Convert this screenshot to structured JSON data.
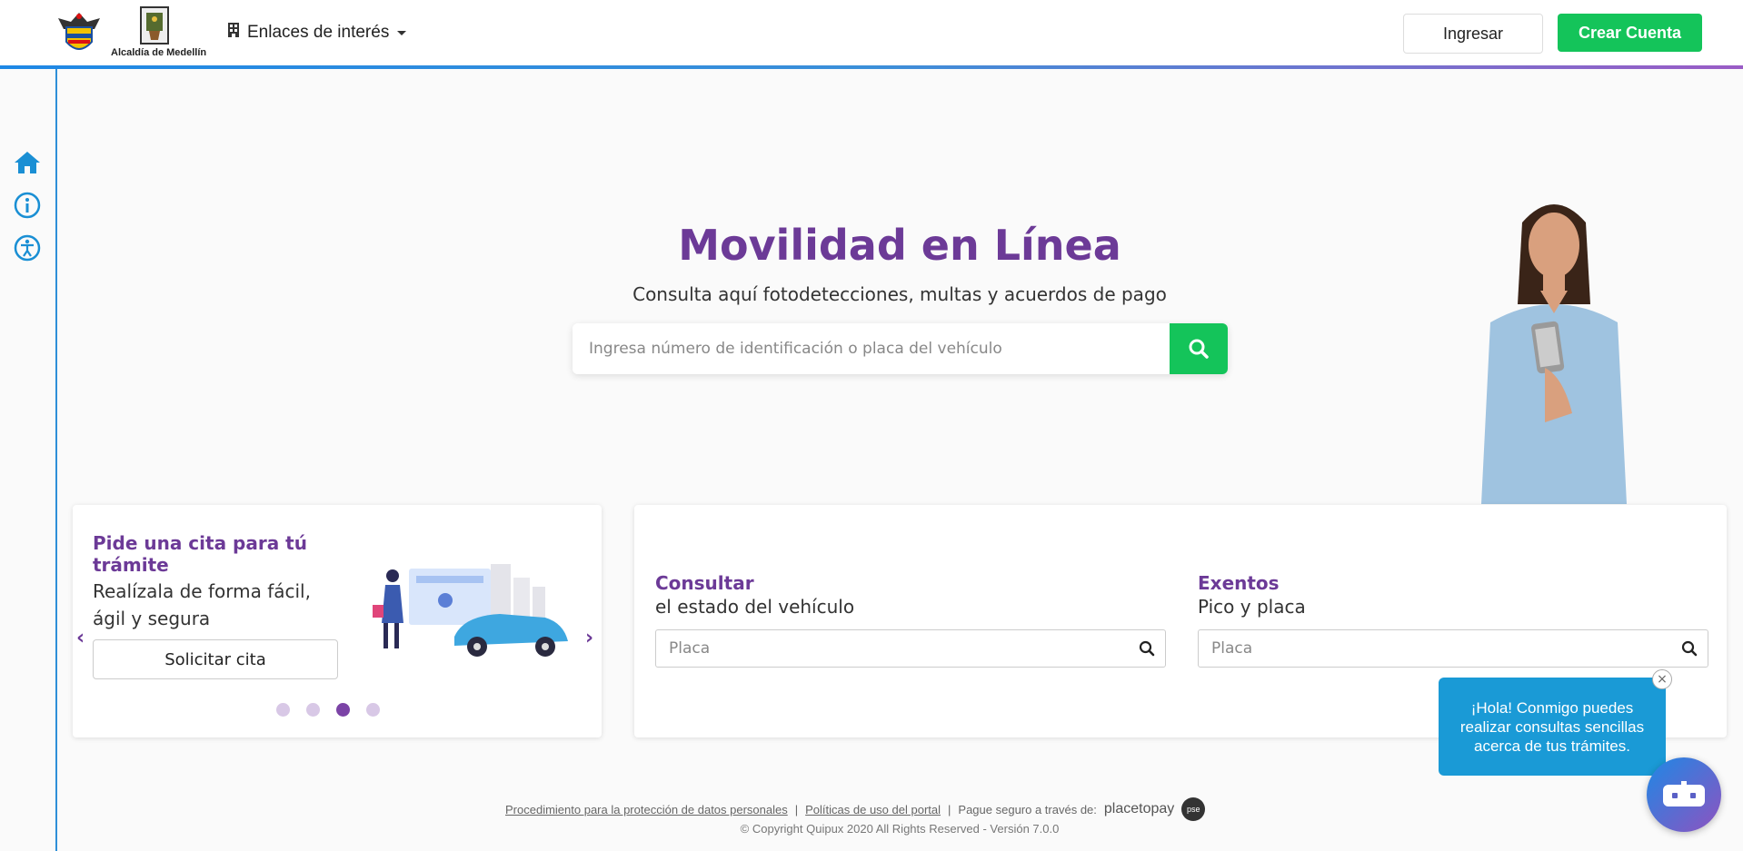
{
  "header": {
    "logo_text": "Alcaldía de Medellín",
    "links_menu_label": "Enlaces de interés",
    "login_label": "Ingresar",
    "signup_label": "Crear Cuenta"
  },
  "sidebar": {
    "items": [
      {
        "icon": "home-icon"
      },
      {
        "icon": "info-icon"
      },
      {
        "icon": "accessibility-icon"
      }
    ]
  },
  "hero": {
    "title": "Movilidad en Línea",
    "subtitle": "Consulta aquí fotodetecciones, multas y acuerdos de pago",
    "search_placeholder": "Ingresa número de identificación o placa del vehículo"
  },
  "cita_card": {
    "title": "Pide una cita para tú trámite",
    "description": "Realízala de forma fácil, ágil y segura",
    "button_label": "Solicitar cita",
    "prev_arrow": "‹",
    "next_arrow": "›",
    "slides": 4,
    "active_slide": 3
  },
  "consultas": {
    "vehiculo": {
      "title": "Consultar",
      "subtitle": "el estado del vehículo",
      "placeholder": "Placa"
    },
    "exentos": {
      "title": "Exentos",
      "subtitle": "Pico y placa",
      "placeholder": "Placa"
    }
  },
  "footer": {
    "link_privacy": "Procedimiento para la protección de datos personales",
    "link_terms": "Políticas de uso del portal",
    "separator": "|",
    "pay_text": "Pague seguro a través de:",
    "placetopay": "placetopay",
    "pse": "pse",
    "copyright": "© Copyright Quipux 2020 All Rights Reserved - Versión 7.0.0"
  },
  "chat": {
    "message": "¡Hola! Conmigo puedes realizar consultas sencillas acerca de tus trámites.",
    "close": "×"
  },
  "colors": {
    "brand_purple": "#6c3a97",
    "accent_green": "#14c45a",
    "accent_blue": "#1a9ad6"
  }
}
